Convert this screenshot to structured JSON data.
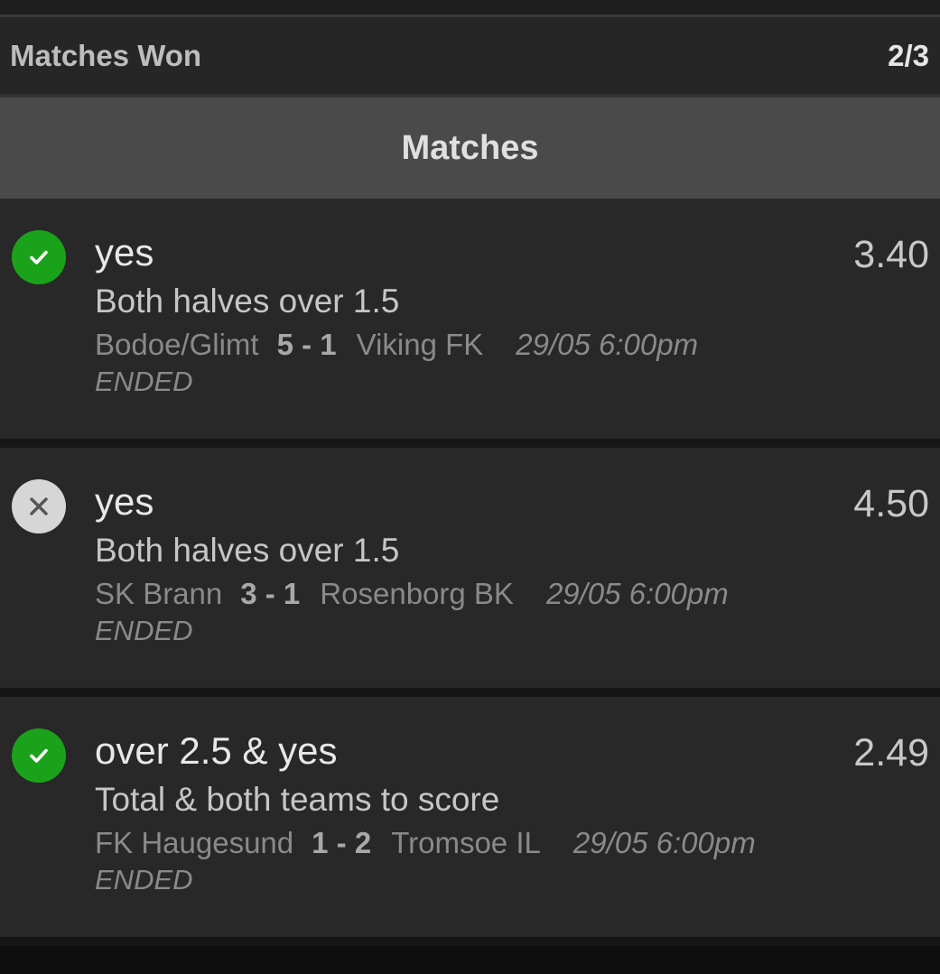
{
  "summary": {
    "label": "Matches Won",
    "value": "2/3"
  },
  "section": {
    "title": "Matches"
  },
  "matches": [
    {
      "status": "won",
      "status_icon": "check-icon",
      "pick": "yes",
      "market": "Both halves over 1.5",
      "home": "Bodoe/Glimt",
      "score": "5 - 1",
      "away": "Viking FK",
      "kickoff": "29/05 6:00pm",
      "state": "ENDED",
      "odds": "3.40"
    },
    {
      "status": "lost",
      "status_icon": "close-icon",
      "pick": "yes",
      "market": "Both halves over 1.5",
      "home": "SK Brann",
      "score": "3 - 1",
      "away": "Rosenborg BK",
      "kickoff": "29/05 6:00pm",
      "state": "ENDED",
      "odds": "4.50"
    },
    {
      "status": "won",
      "status_icon": "check-icon",
      "pick": "over 2.5 & yes",
      "market": "Total & both teams to score",
      "home": "FK Haugesund",
      "score": "1 - 2",
      "away": "Tromsoe IL",
      "kickoff": "29/05 6:00pm",
      "state": "ENDED",
      "odds": "2.49"
    }
  ],
  "colors": {
    "won": "#1ba21b",
    "lost": "#d6d6d6",
    "background": "#161616",
    "card": "#282828",
    "header": "#4a4a4a"
  }
}
